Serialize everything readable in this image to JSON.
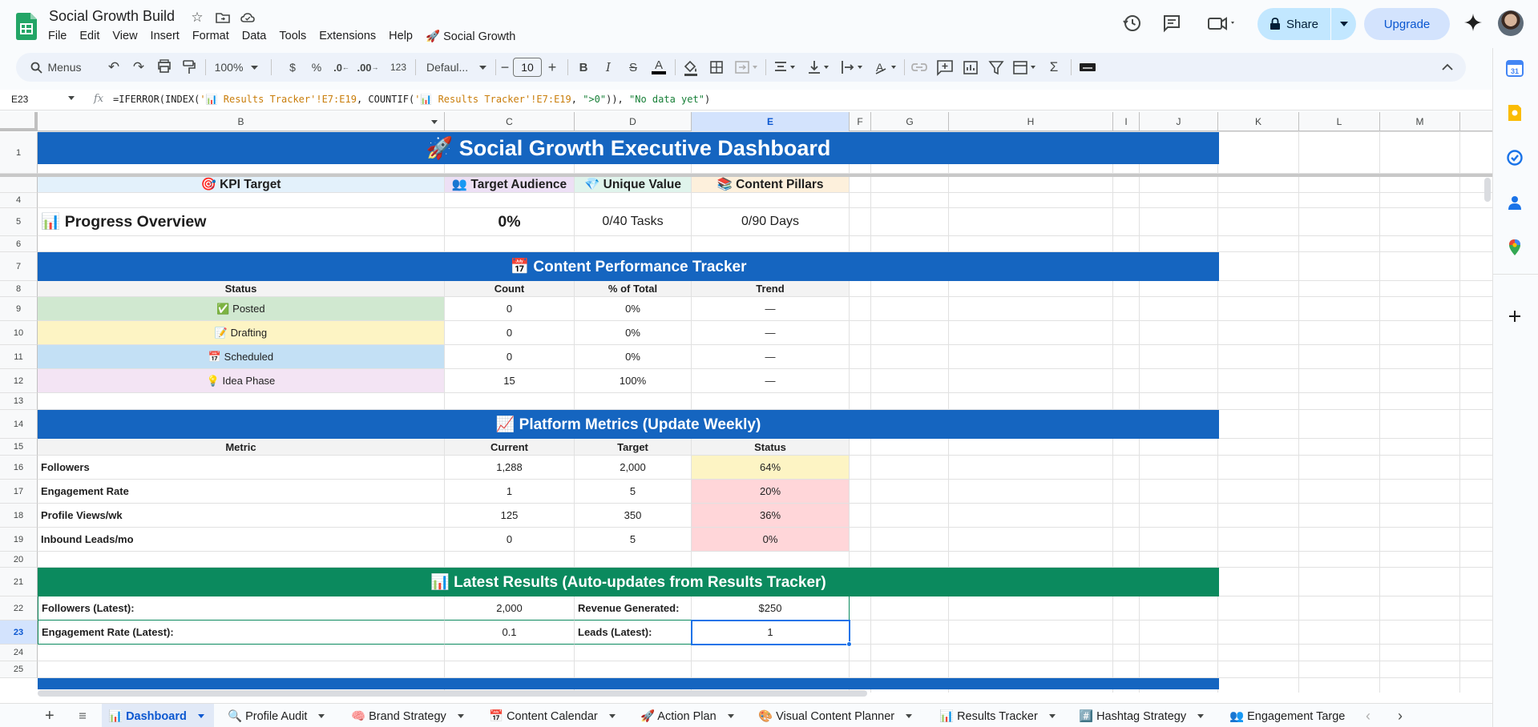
{
  "app": {
    "doc_title": "Social Growth Build",
    "menus": [
      "File",
      "Edit",
      "View",
      "Insert",
      "Format",
      "Data",
      "Tools",
      "Extensions",
      "Help",
      "🚀 Social Growth"
    ],
    "share_label": "Share",
    "upgrade_label": "Upgrade"
  },
  "toolbar": {
    "menus_label": "Menus",
    "zoom": "100%",
    "currency": "$",
    "percent": "%",
    "dec_decrease": ".0",
    "dec_increase": ".00",
    "number_format": "123",
    "font": "Defaul...",
    "font_size": "10"
  },
  "formula_bar": {
    "cell_ref": "E23",
    "fx": "fx",
    "formula_parts": [
      {
        "t": "=IFERROR(INDEX(",
        "c": ""
      },
      {
        "t": "'📊 Results Tracker'!E7:E19",
        "c": "ref"
      },
      {
        "t": ", COUNTIF(",
        "c": ""
      },
      {
        "t": "'📊 Results Tracker'!E7:E19",
        "c": "ref"
      },
      {
        "t": ", ",
        "c": ""
      },
      {
        "t": "\">0\"",
        "c": "str"
      },
      {
        "t": ")), ",
        "c": ""
      },
      {
        "t": "\"No data yet\"",
        "c": "str"
      },
      {
        "t": ")",
        "c": ""
      }
    ]
  },
  "columns": [
    "B",
    "C",
    "D",
    "E",
    "F",
    "G",
    "H",
    "I",
    "J",
    "K",
    "L",
    "M"
  ],
  "rows": [
    "1",
    "",
    "4",
    "5",
    "6",
    "7",
    "8",
    "9",
    "10",
    "11",
    "12",
    "13",
    "14",
    "15",
    "16",
    "17",
    "18",
    "19",
    "20",
    "21",
    "22",
    "23",
    "24",
    "25"
  ],
  "sheet": {
    "title": "🚀 Social Growth Executive Dashboard",
    "row3": [
      "🎯 KPI Target",
      "👥 Target Audience",
      "💎 Unique Value",
      "📚 Content Pillars"
    ],
    "progress": {
      "label": "📊 Progress Overview",
      "pct": "0%",
      "tasks": "0/40 Tasks",
      "days": "0/90 Days"
    },
    "content_tracker": {
      "title": "📅 Content Performance Tracker",
      "headers": [
        "Status",
        "Count",
        "% of Total",
        "Trend"
      ],
      "rows": [
        {
          "status": "✅ Posted",
          "count": "0",
          "pct": "0%",
          "trend": "—"
        },
        {
          "status": "📝 Drafting",
          "count": "0",
          "pct": "0%",
          "trend": "—"
        },
        {
          "status": "📅 Scheduled",
          "count": "0",
          "pct": "0%",
          "trend": "—"
        },
        {
          "status": "💡 Idea Phase",
          "count": "15",
          "pct": "100%",
          "trend": "—"
        }
      ]
    },
    "platform_metrics": {
      "title": "📈 Platform Metrics (Update Weekly)",
      "headers": [
        "Metric",
        "Current",
        "Target",
        "Status"
      ],
      "rows": [
        {
          "metric": "Followers",
          "current": "1,288",
          "target": "2,000",
          "status": "64%"
        },
        {
          "metric": "Engagement Rate",
          "current": "1",
          "target": "5",
          "status": "20%"
        },
        {
          "metric": "Profile Views/wk",
          "current": "125",
          "target": "350",
          "status": "36%"
        },
        {
          "metric": "Inbound Leads/mo",
          "current": "0",
          "target": "5",
          "status": "0%"
        }
      ]
    },
    "latest_results": {
      "title": "📊 Latest Results (Auto-updates from Results Tracker)",
      "row22": {
        "label": "Followers (Latest):",
        "value": "2,000",
        "label2": "Revenue Generated:",
        "value2": "$250"
      },
      "row23": {
        "label": "Engagement Rate (Latest):",
        "value": "0.1",
        "label2": "Leads (Latest):",
        "value2": "1"
      }
    }
  },
  "tabs": [
    "📊 Dashboard",
    "🔍 Profile Audit",
    "🧠 Brand Strategy",
    "📅 Content Calendar",
    "🚀 Action Plan",
    "🎨 Visual Content Planner",
    "📊 Results Tracker",
    "#️⃣ Hashtag Strategy",
    "👥 Engagement Targe"
  ],
  "colors": {
    "blue_banner": "#1565c0",
    "green_banner": "#0b8a5e",
    "posted": "#d0e8d0",
    "drafting": "#fdf4c4",
    "scheduled": "#c3e0f5",
    "idea": "#f3e4f4",
    "status_yellow": "#fdf4c4",
    "status_red": "#ffd6d9"
  }
}
